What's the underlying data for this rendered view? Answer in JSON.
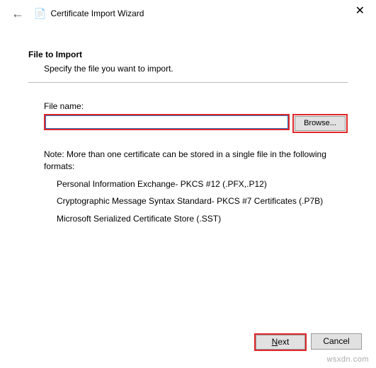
{
  "header": {
    "wizard_icon": "📄",
    "title": "Certificate Import Wizard",
    "back_arrow": "←",
    "close_label": "✕"
  },
  "section": {
    "heading": "File to Import",
    "sub": "Specify the file you want to import."
  },
  "filefield": {
    "label": "File name:",
    "value": "",
    "browse_label": "Browse..."
  },
  "note": {
    "intro": "Note:  More than one certificate can be stored in a single file in the following formats:",
    "line1": "Personal Information Exchange- PKCS #12 (.PFX,.P12)",
    "line2": "Cryptographic Message Syntax Standard- PKCS #7 Certificates (.P7B)",
    "line3": "Microsoft Serialized Certificate Store (.SST)"
  },
  "footer": {
    "next_label": "Next",
    "cancel_label": "Cancel"
  },
  "watermark": "wsxdn.com"
}
